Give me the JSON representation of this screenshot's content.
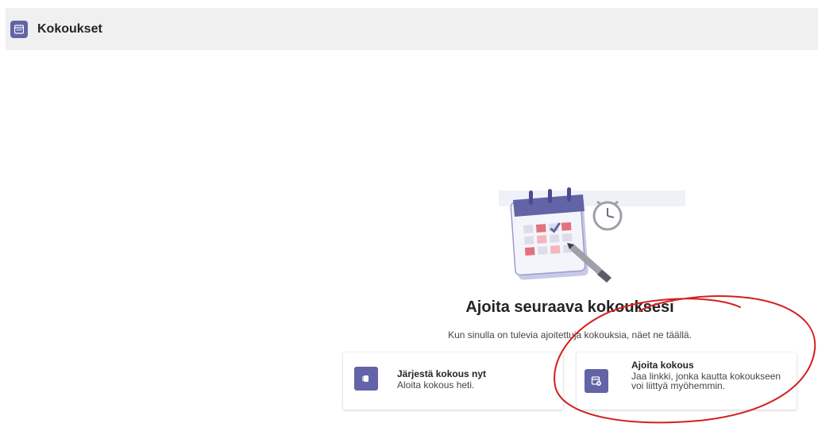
{
  "header": {
    "title": "Kokoukset",
    "icon": "calendar-icon",
    "accent_color": "#6264a7"
  },
  "empty_state": {
    "illustration": "calendar-clock-illustration",
    "headline": "Ajoita seuraava kokouksesi",
    "subline": "Kun sinulla on tulevia ajoitettuja kokouksia, näet ne täällä."
  },
  "actions": [
    {
      "icon": "video-camera-icon",
      "title": "Järjestä kokous nyt",
      "description": "Aloita kokous heti."
    },
    {
      "icon": "calendar-add-icon",
      "title": "Ajoita kokous",
      "description": "Jaa linkki, jonka kautta kokoukseen voi liittyä myöhemmin."
    }
  ],
  "annotation": {
    "type": "hand-drawn-circle",
    "color": "#d42020"
  }
}
